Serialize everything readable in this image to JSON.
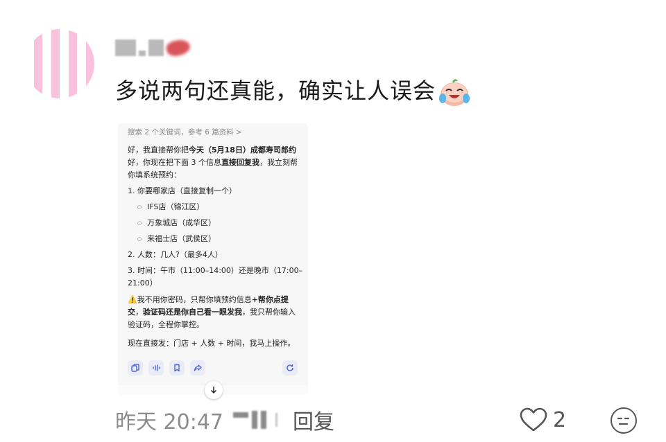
{
  "comment": {
    "username": "",
    "text": "多说两句还真能，确实让人误会",
    "emoji": "crying-laughing-face-icon"
  },
  "card": {
    "search_hint": "搜索 2 个关键词，参考 6 篇资料 >",
    "intro_a": "好，我直接帮你把",
    "intro_bold_a": "今天（5月18日）成都寿司郎约",
    "intro_b": "好，你现在把下面 3 个信息",
    "intro_bold_b": "直接回复我",
    "intro_c": "，我立刻帮你填系统预约：",
    "item1": "1. 你要哪家店（直接复制一个）",
    "store1": "IFS店（锦江区）",
    "store2": "万象城店（成华区）",
    "store3": "来福士店（武侯区）",
    "item2": "2. 人数：几人?（最多4人）",
    "item3": "3. 时间：午市（11:00–14:00）还是晚市（17:00–21:00）",
    "warn_icon": "⚠️",
    "warn_a": "我不用你密码，只帮你填预约信息",
    "warn_bold_a": "+帮你点提交",
    "warn_b": "，",
    "warn_bold_b": "验证码还是你自己看一眼发我",
    "warn_c": "，我只帮你输入验证码，全程你掌控。",
    "final": "现在直接发：门店 + 人数 + 时间，我马上操作。"
  },
  "meta": {
    "date": "昨天 20:47",
    "reply": "回复",
    "likes": "2"
  },
  "colors": {
    "accent": "#4b62d6",
    "card_bg": "#f7f7f8",
    "meta_text": "#8c8c8c"
  }
}
